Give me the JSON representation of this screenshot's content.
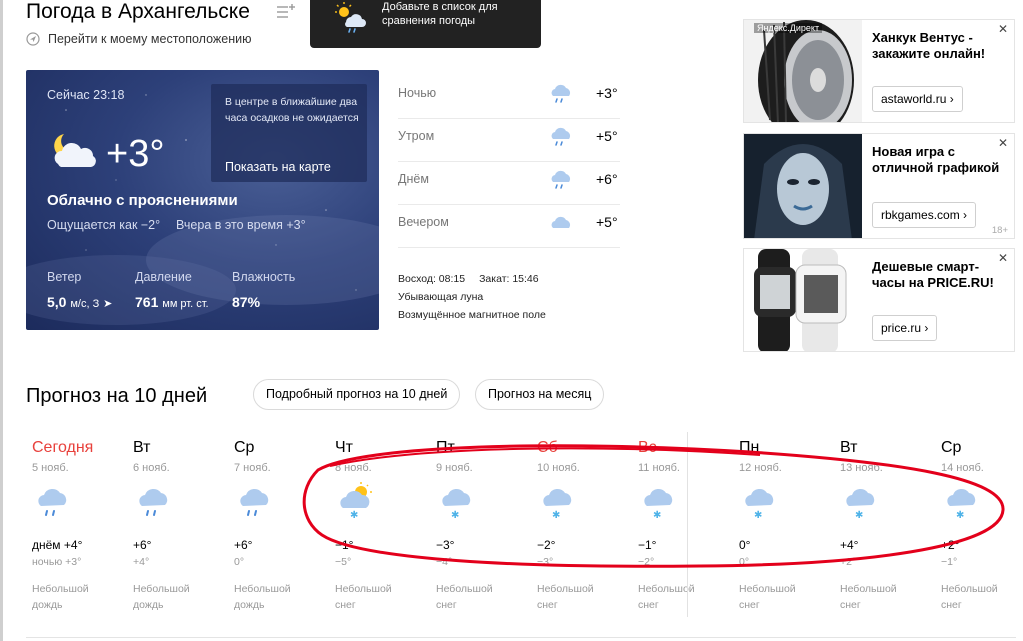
{
  "header": {
    "title": "Погода в Архангельске",
    "locate_label": "Перейти к моему местоположению",
    "tooltip_text": "Добавьте в список для сравнения погоды"
  },
  "now": {
    "time_label": "Сейчас 23:18",
    "temp": "+3°",
    "condition": "Облачно с прояснениями",
    "feels": "Ощущается как −2°",
    "yesterday": "Вчера в это время +3°",
    "precip_text": "В центре в ближайшие два часа осадков не ожидается",
    "map_link": "Показать на карте",
    "wind_label": "Ветер",
    "wind_value": "5,0",
    "wind_unit": "м/с, З",
    "pressure_label": "Давление",
    "pressure_value": "761",
    "pressure_unit": "мм рт. ст.",
    "humidity_label": "Влажность",
    "humidity_value": "87%"
  },
  "dayparts": [
    {
      "label": "Ночью",
      "temp": "+3°",
      "icon": "cloud-rain-icon"
    },
    {
      "label": "Утром",
      "temp": "+5°",
      "icon": "cloud-rain-icon"
    },
    {
      "label": "Днём",
      "temp": "+6°",
      "icon": "cloud-rain-icon"
    },
    {
      "label": "Вечером",
      "temp": "+5°",
      "icon": "cloud-icon"
    }
  ],
  "astro": {
    "sunrise": "Восход: 08:15",
    "sunset": "Закат: 15:46",
    "moon": "Убывающая луна",
    "magnetic": "Возмущённое магнитное поле"
  },
  "ads": [
    {
      "title": "Ханкук Вентус - закажите онлайн!",
      "button": "astaworld.ru ›",
      "badge": "Яндекс.Директ",
      "age": ""
    },
    {
      "title": "Новая игра с отличной графикой",
      "button": "rbkgames.com ›",
      "badge": "",
      "age": "18+"
    },
    {
      "title": "Дешевые смарт-часы на PRICE.RU!",
      "button": "price.ru ›",
      "badge": "",
      "age": ""
    }
  ],
  "forecast": {
    "title": "Прогноз на 10 дней",
    "detailed_button": "Подробный прогноз на 10 дней",
    "month_button": "Прогноз на месяц",
    "days": [
      {
        "dow": "Сегодня",
        "date": "5 нояб.",
        "day": "днём +4°",
        "night": "ночью +3°",
        "cond1": "Небольшой",
        "cond2": "дождь",
        "icon": "rain",
        "red": true
      },
      {
        "dow": "Вт",
        "date": "6 нояб.",
        "day": "+6°",
        "night": "+4°",
        "cond1": "Небольшой",
        "cond2": "дождь",
        "icon": "rain",
        "red": false
      },
      {
        "dow": "Ср",
        "date": "7 нояб.",
        "day": "+6°",
        "night": "0°",
        "cond1": "Небольшой",
        "cond2": "дождь",
        "icon": "rain",
        "red": false
      },
      {
        "dow": "Чт",
        "date": "8 нояб.",
        "day": "−1°",
        "night": "−5°",
        "cond1": "Небольшой",
        "cond2": "снег",
        "icon": "sun-snow",
        "red": false
      },
      {
        "dow": "Пт",
        "date": "9 нояб.",
        "day": "−3°",
        "night": "−4°",
        "cond1": "Небольшой",
        "cond2": "снег",
        "icon": "snow",
        "red": false
      },
      {
        "dow": "Сб",
        "date": "10 нояб.",
        "day": "−2°",
        "night": "−3°",
        "cond1": "Небольшой",
        "cond2": "снег",
        "icon": "snow",
        "red": true
      },
      {
        "dow": "Вс",
        "date": "11 нояб.",
        "day": "−1°",
        "night": "−2°",
        "cond1": "Небольшой",
        "cond2": "снег",
        "icon": "snow",
        "red": true
      },
      {
        "dow": "Пн",
        "date": "12 нояб.",
        "day": "0°",
        "night": "0°",
        "cond1": "Небольшой",
        "cond2": "снег",
        "icon": "snow",
        "red": false
      },
      {
        "dow": "Вт",
        "date": "13 нояб.",
        "day": "+4°",
        "night": "+2°",
        "cond1": "Небольшой",
        "cond2": "снег",
        "icon": "snow",
        "red": false
      },
      {
        "dow": "Ср",
        "date": "14 нояб.",
        "day": "+2°",
        "night": "−1°",
        "cond1": "Небольшой",
        "cond2": "снег",
        "icon": "snow",
        "red": false
      }
    ]
  },
  "colors": {
    "accent_red": "#e8413c",
    "card_bg": "#2d4079",
    "annotation": "#e3001b",
    "rain_drop": "#4a8ad8",
    "snow_flake": "#4fb3e8"
  }
}
